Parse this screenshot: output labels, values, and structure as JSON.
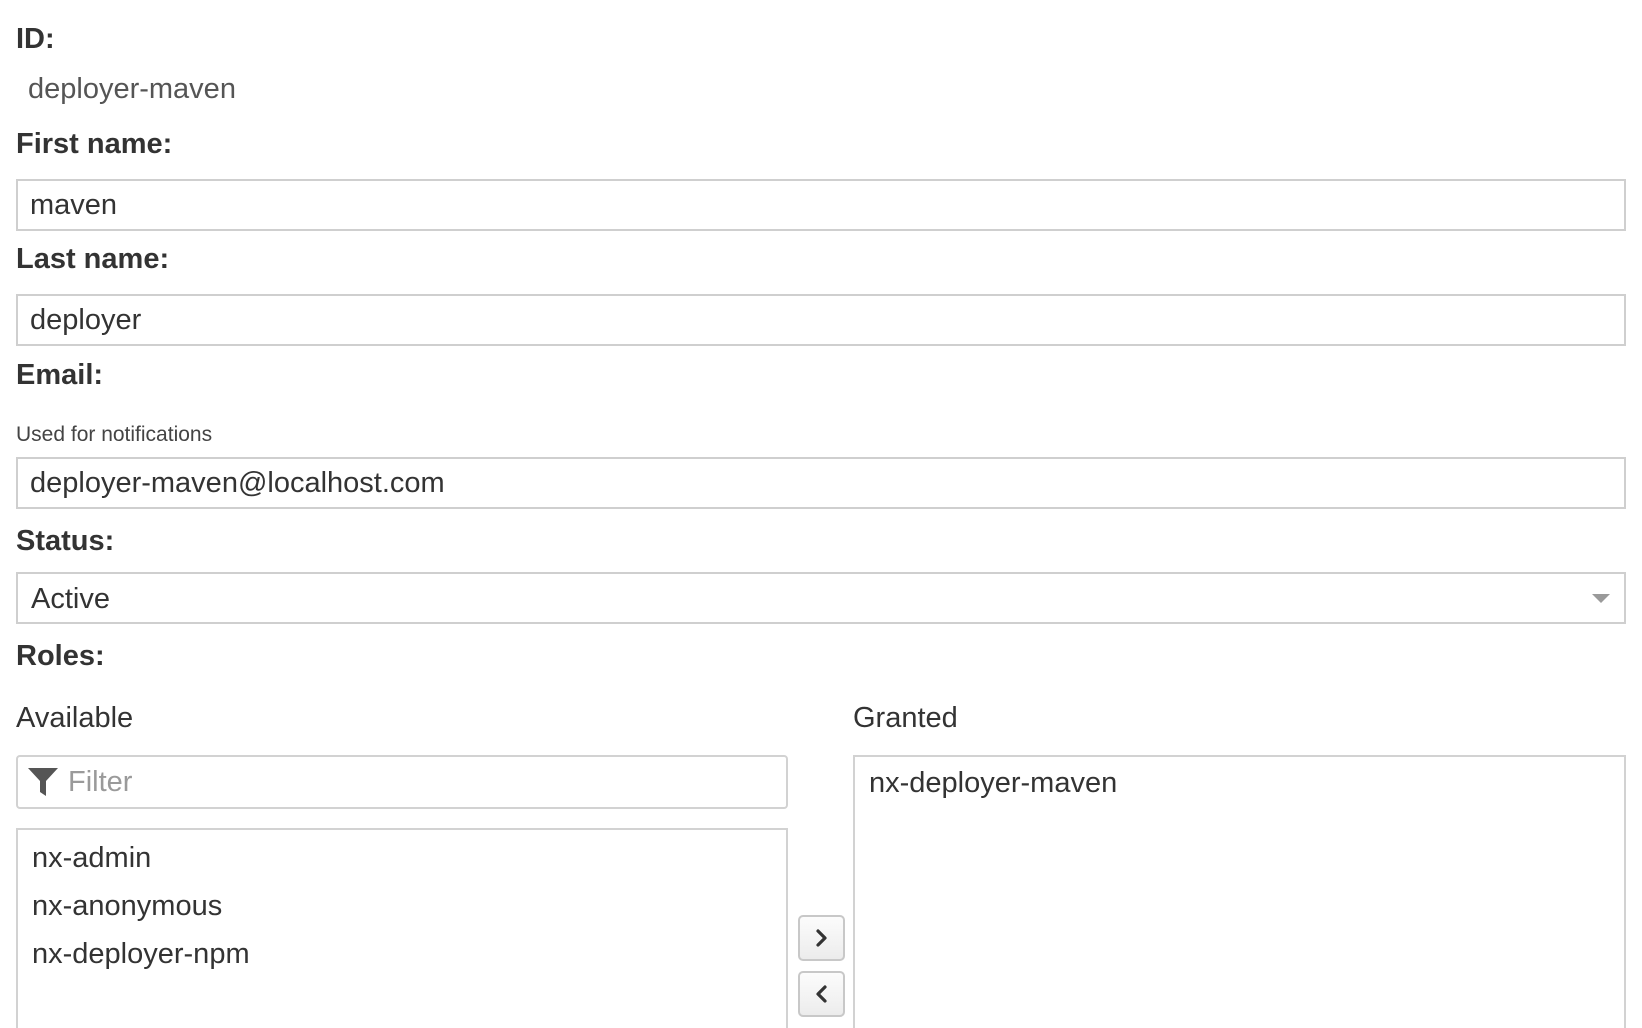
{
  "form": {
    "id": {
      "label": "ID:",
      "value": "deployer-maven"
    },
    "first_name": {
      "label": "First name:",
      "value": "maven"
    },
    "last_name": {
      "label": "Last name:",
      "value": "deployer"
    },
    "email": {
      "label": "Email:",
      "help": "Used for notifications",
      "value": "deployer-maven@localhost.com"
    },
    "status": {
      "label": "Status:",
      "value": "Active"
    },
    "roles": {
      "label": "Roles:",
      "available": {
        "label": "Available",
        "filter_placeholder": "Filter",
        "items": [
          "nx-admin",
          "nx-anonymous",
          "nx-deployer-npm"
        ]
      },
      "granted": {
        "label": "Granted",
        "items": [
          "nx-deployer-maven"
        ]
      },
      "controls": {
        "add_icon": "chevron-right-icon",
        "remove_icon": "chevron-left-icon"
      }
    }
  },
  "colors": {
    "text": "#333333",
    "border": "#cfcfcf",
    "placeholder": "#9a9a9a",
    "icon": "#555555"
  }
}
